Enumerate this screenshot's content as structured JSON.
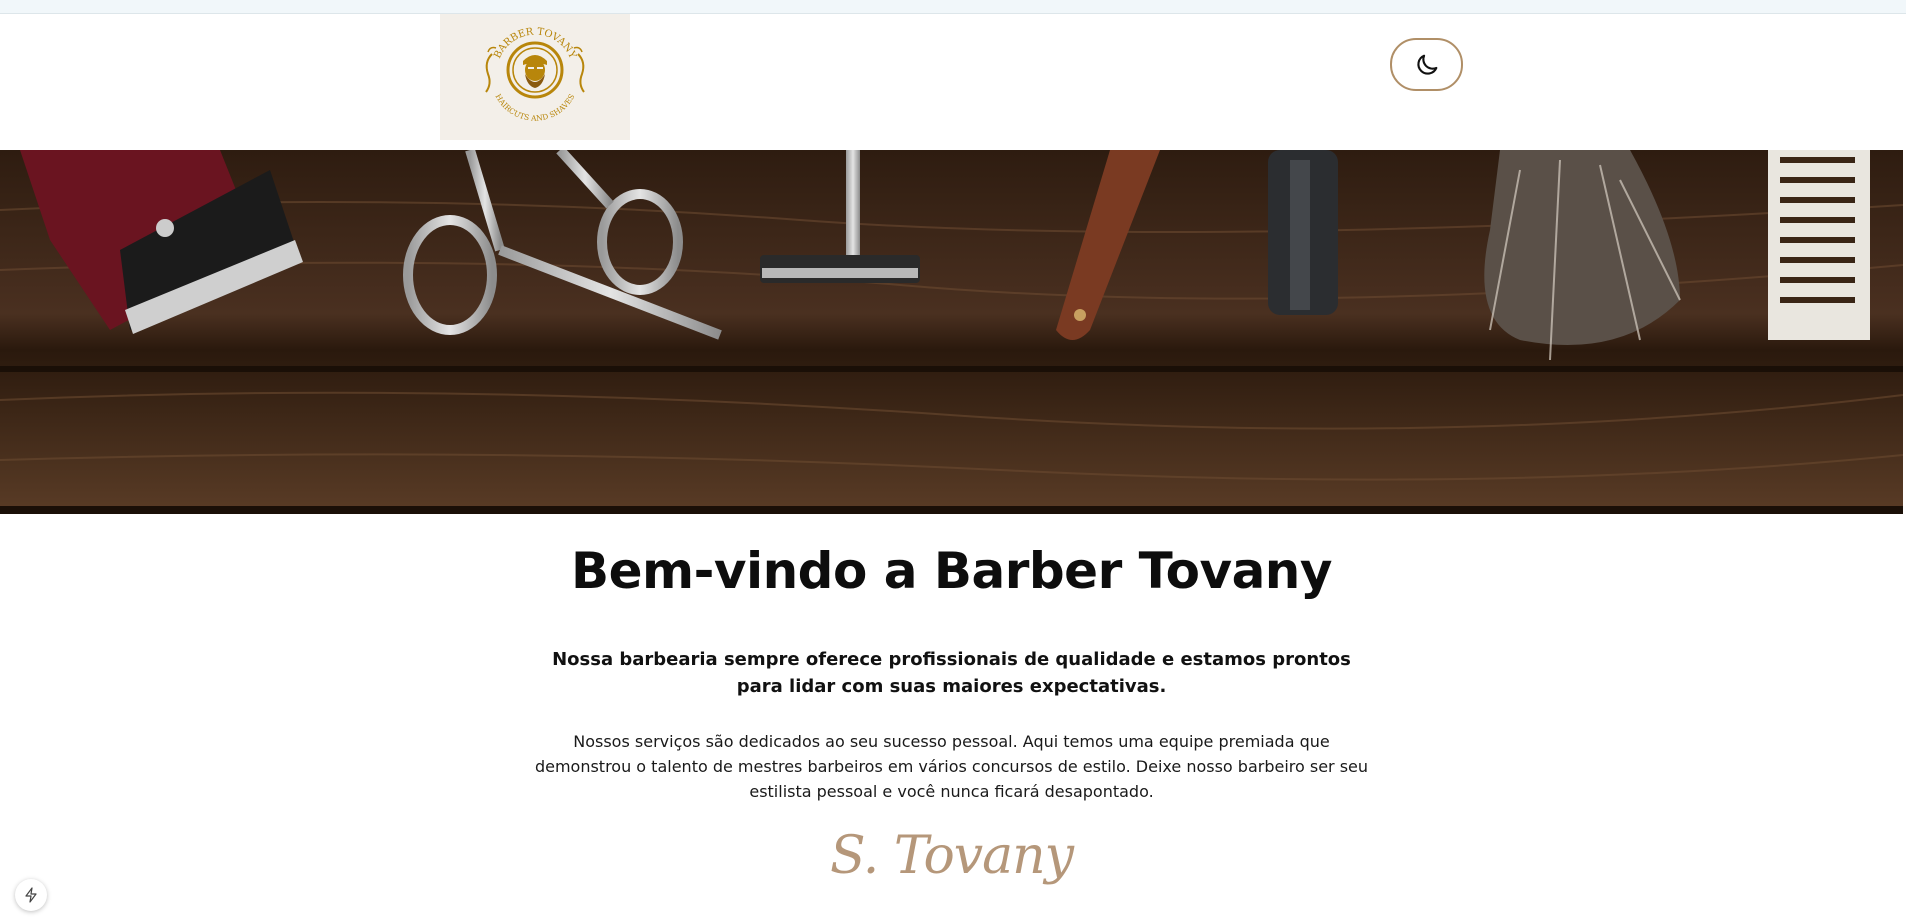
{
  "header": {
    "logo": {
      "top_text": "BARBER TOVANY",
      "bottom_text": "HAIRCUTS AND SHAVES"
    },
    "theme_toggle": {
      "icon": "moon-icon"
    }
  },
  "hero": {
    "image": "barber-tools-on-wood-banner"
  },
  "content": {
    "title": "Bem-vindo a Barber Tovany",
    "lead": "Nossa barbearia sempre oferece profissionais de qualidade e estamos prontos para lidar com suas maiores expectativas.",
    "body": "Nossos serviços são dedicados ao seu sucesso pessoal. Aqui temos uma equipe premiada que demonstrou o talento de mestres barbeiros em vários concursos de estilo. Deixe nosso barbeiro ser seu estilista pessoal e você nunca ficará desapontado.",
    "signature": "S. Tovany"
  },
  "floating_button": {
    "icon": "lightning-icon"
  },
  "colors": {
    "accent_gold": "#b5977a",
    "logo_gold": "#b8860b",
    "toggle_border": "#b08f67"
  }
}
